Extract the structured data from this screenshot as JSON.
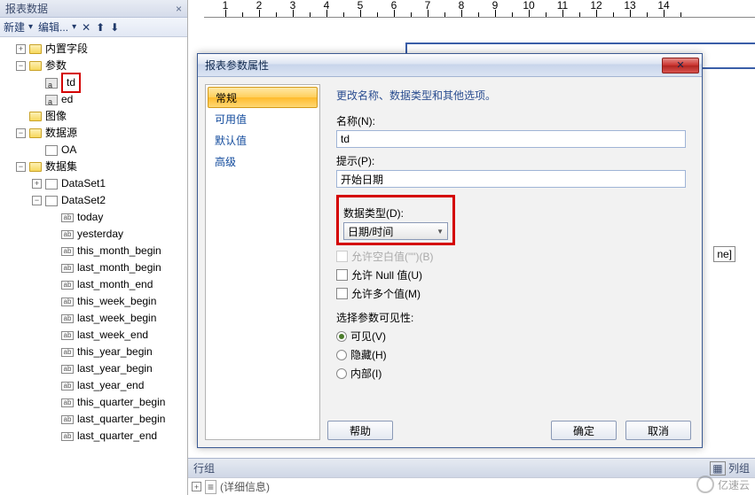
{
  "panel": {
    "title": "报表数据",
    "toolbar": {
      "new": "新建",
      "edit": "编辑..."
    }
  },
  "tree": {
    "builtin": "内置字段",
    "params": "参数",
    "param_items": [
      "td",
      "ed"
    ],
    "images": "图像",
    "datasources": "数据源",
    "ds_items": [
      "OA"
    ],
    "datasets": "数据集",
    "set1": "DataSet1",
    "set2": "DataSet2",
    "fields": [
      "today",
      "yesterday",
      "this_month_begin",
      "last_month_begin",
      "last_month_end",
      "this_week_begin",
      "last_week_begin",
      "last_week_end",
      "this_year_begin",
      "last_year_begin",
      "last_year_end",
      "this_quarter_begin",
      "last_quarter_begin",
      "last_quarter_end"
    ]
  },
  "ruler": [
    "1",
    "2",
    "3",
    "4",
    "5",
    "6",
    "7",
    "8",
    "9",
    "10",
    "11",
    "12",
    "13",
    "14"
  ],
  "dialog": {
    "title": "报表参数属性",
    "tabs": [
      "常规",
      "可用值",
      "默认值",
      "高级"
    ],
    "caption": "更改名称、数据类型和其他选项。",
    "name_label": "名称(N):",
    "name_value": "td",
    "prompt_label": "提示(P):",
    "prompt_value": "开始日期",
    "dtype_label": "数据类型(D):",
    "dtype_value": "日期/时间",
    "cb_blank": "允许空白值(\"\")(B)",
    "cb_null": "允许 Null 值(U)",
    "cb_multi": "允许多个值(M)",
    "vis_label": "选择参数可见性:",
    "rb_visible": "可见(V)",
    "rb_hidden": "隐藏(H)",
    "rb_internal": "内部(I)",
    "help": "帮助",
    "ok": "确定",
    "cancel": "取消"
  },
  "bottom": {
    "rowgroup": "行组",
    "colgroup": "列组"
  },
  "detail": "(详细信息)",
  "watermark": "亿速云",
  "partial_label": "ne]"
}
